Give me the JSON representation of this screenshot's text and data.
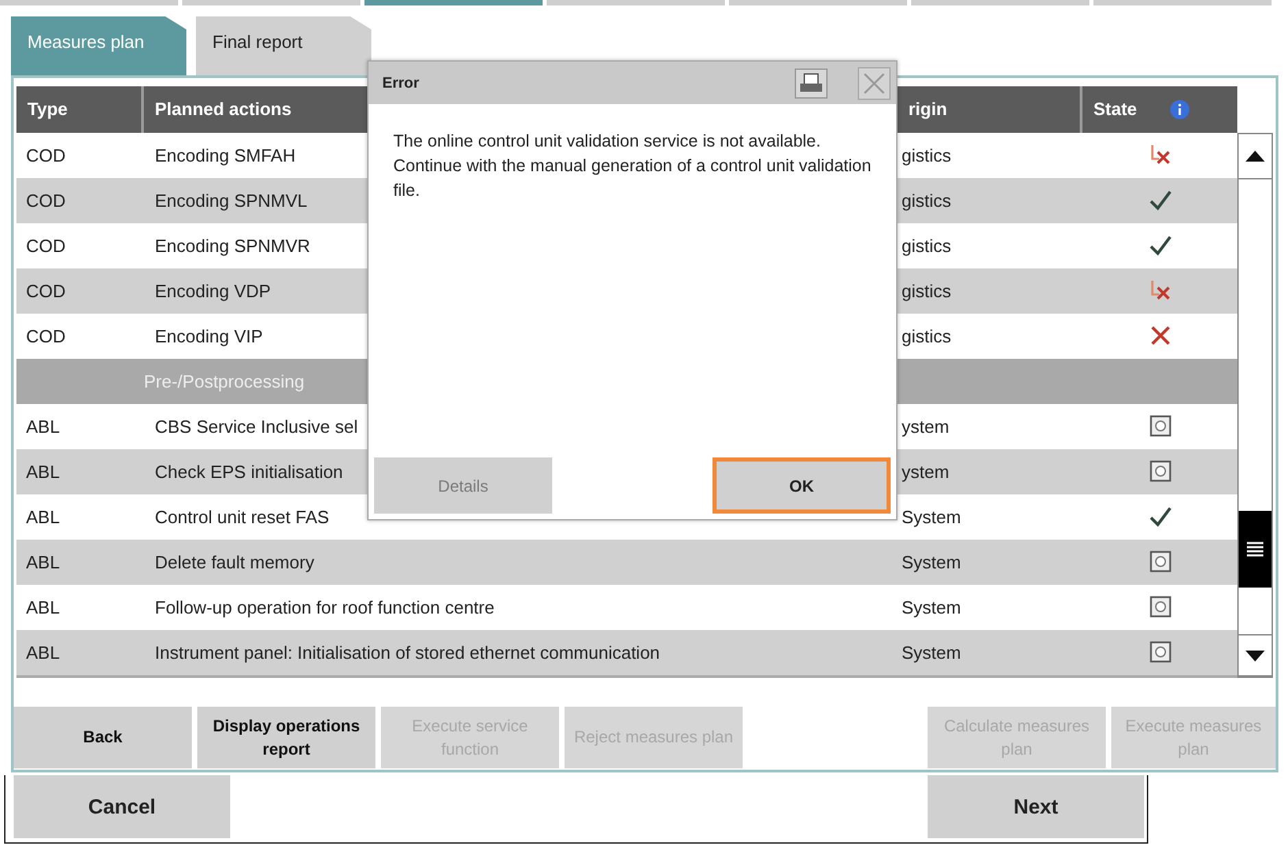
{
  "top_tabs": [
    {
      "selected": false
    },
    {
      "selected": false
    },
    {
      "selected": true
    },
    {
      "selected": false
    },
    {
      "selected": false
    },
    {
      "selected": false
    },
    {
      "selected": false
    }
  ],
  "tabs": [
    {
      "label": "Measures plan",
      "selected": true
    },
    {
      "label": "Final report",
      "selected": false
    }
  ],
  "table": {
    "columns": [
      "Type",
      "Planned actions",
      "rigin",
      "State"
    ],
    "rows": [
      {
        "kind": "action",
        "type": "COD",
        "action": "Encoding SMFAH",
        "origin": "gistics",
        "state": {
          "kind": "partial"
        }
      },
      {
        "kind": "action",
        "type": "COD",
        "action": "Encoding SPNMVL",
        "origin": "gistics",
        "state": {
          "kind": "done"
        }
      },
      {
        "kind": "action",
        "type": "COD",
        "action": "Encoding SPNMVR",
        "origin": "gistics",
        "state": {
          "kind": "done"
        }
      },
      {
        "kind": "action",
        "type": "COD",
        "action": "Encoding VDP",
        "origin": "gistics",
        "state": {
          "kind": "partial"
        }
      },
      {
        "kind": "action",
        "type": "COD",
        "action": "Encoding VIP",
        "origin": "gistics",
        "state": {
          "kind": "failed"
        }
      },
      {
        "kind": "group",
        "action": "Pre-/Postprocessing"
      },
      {
        "kind": "action",
        "type": "ABL",
        "action": "CBS Service Inclusive sel",
        "origin": "ystem",
        "state": {
          "kind": "pending"
        }
      },
      {
        "kind": "action",
        "type": "ABL",
        "action": "Check EPS initialisation",
        "origin": "ystem",
        "state": {
          "kind": "pending"
        }
      },
      {
        "kind": "action",
        "type": "ABL",
        "action": "Control unit reset FAS",
        "origin": "System",
        "state": {
          "kind": "done"
        }
      },
      {
        "kind": "action",
        "type": "ABL",
        "action": "Delete fault memory",
        "origin": "System",
        "state": {
          "kind": "pending"
        }
      },
      {
        "kind": "action",
        "type": "ABL",
        "action": "Follow-up operation for roof function centre",
        "origin": "System",
        "state": {
          "kind": "pending"
        }
      },
      {
        "kind": "action",
        "type": "ABL",
        "action": "Instrument panel: Initialisation of stored ethernet communication",
        "origin": "System",
        "state": {
          "kind": "pending"
        }
      }
    ]
  },
  "action_buttons": [
    {
      "label": "Back",
      "disabled": false
    },
    {
      "label": "Display operations report",
      "disabled": false
    },
    {
      "label": "Execute service function",
      "disabled": true
    },
    {
      "label": "Reject measures plan",
      "disabled": true
    },
    {
      "label": "Calculate measures plan",
      "disabled": true
    },
    {
      "label": "Execute measures plan",
      "disabled": true
    }
  ],
  "footer_buttons": [
    "Cancel",
    "Next"
  ],
  "dialog": {
    "title": "Error",
    "message": "The online control unit validation service is not available. Continue with the manual generation of a control unit validation file.",
    "buttons": [
      {
        "label": "Details",
        "disabled": true,
        "focused": false
      },
      {
        "label": "OK",
        "disabled": false,
        "focused": true
      }
    ]
  }
}
